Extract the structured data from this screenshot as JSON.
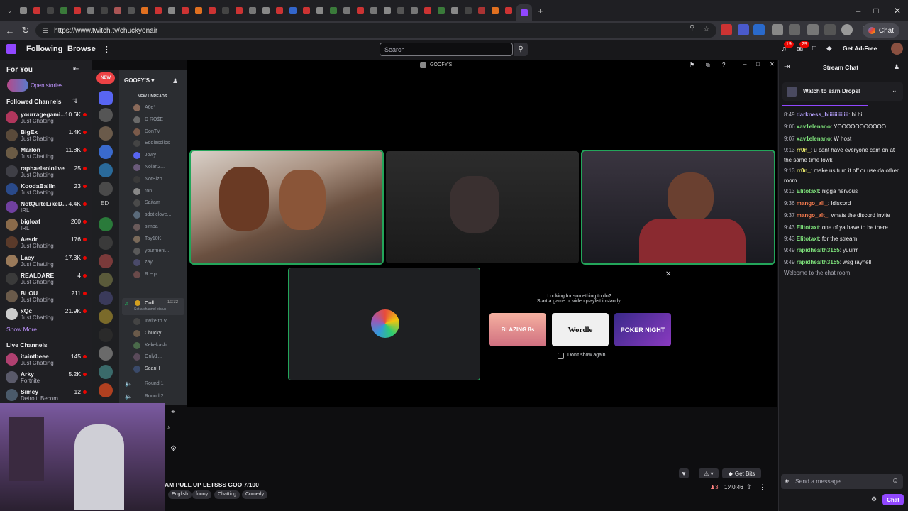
{
  "browser": {
    "url": "https://www.twitch.tv/chuckyonair",
    "chat_button": "Chat",
    "tabs_count": 44
  },
  "twitch_nav": {
    "following": "Following",
    "browse": "Browse",
    "search_placeholder": "Search",
    "notif_badge_1": "19",
    "notif_badge_2": "29",
    "get_ad_free": "Get Ad-Free"
  },
  "sidebar": {
    "for_you": "For You",
    "open_stories": "Open stories",
    "followed_header": "Followed Channels",
    "followed": [
      {
        "name": "yourragegami...",
        "category": "Just Chatting",
        "viewers": "10.6K",
        "color": "#b0365c"
      },
      {
        "name": "BigEx",
        "category": "Just Chatting",
        "viewers": "1.4K",
        "color": "#5a4a3a"
      },
      {
        "name": "Marlon",
        "category": "Just Chatting",
        "viewers": "11.8K",
        "color": "#6b5b45"
      },
      {
        "name": "raphaelsololive",
        "category": "Just Chatting",
        "viewers": "25",
        "color": "#3f3f46"
      },
      {
        "name": "KoodaBallin",
        "category": "Just Chatting",
        "viewers": "23",
        "color": "#2a4a8a"
      },
      {
        "name": "NotQuiteLikeD...",
        "category": "IRL",
        "viewers": "4.4K",
        "color": "#7040a0"
      },
      {
        "name": "bigloaf",
        "category": "IRL",
        "viewers": "260",
        "color": "#8a6a4a"
      },
      {
        "name": "Aesdr",
        "category": "Just Chatting",
        "viewers": "176",
        "color": "#5a3a2a"
      },
      {
        "name": "Lacy",
        "category": "Just Chatting",
        "viewers": "17.3K",
        "color": "#9a7a5a"
      },
      {
        "name": "REALDARE",
        "category": "Just Chatting",
        "viewers": "4",
        "color": "#3a3a3a"
      },
      {
        "name": "BLOU",
        "category": "Just Chatting",
        "viewers": "211",
        "color": "#6a5a4a"
      },
      {
        "name": "xQc",
        "category": "Just Chatting",
        "viewers": "21.9K",
        "color": "#cccccc"
      }
    ],
    "show_more": "Show More",
    "live_header": "Live Channels",
    "live": [
      {
        "name": "itaintbeee",
        "category": "Just Chatting",
        "viewers": "145",
        "color": "#b04070"
      },
      {
        "name": "Arky",
        "category": "Fortnite",
        "viewers": "5.2K",
        "color": "#5a5a6a"
      },
      {
        "name": "Simey",
        "category": "Detroit: Becom...",
        "viewers": "12",
        "color": "#4a5a6a"
      }
    ]
  },
  "discord": {
    "server_name": "GOOFY'S",
    "new_unreads": "NEW UNREADS",
    "window_title": "GOOFY'S",
    "channels": [
      "A6e*",
      "D RO$E",
      "DonTV",
      "Eddiesclips",
      "Jowy",
      "Nolan2...",
      "NotBizo",
      "ron...",
      "Saitam",
      "sdot clove...",
      "simba",
      "Tay10K",
      "yourmeni...",
      "zay",
      "R e p..."
    ],
    "voice_channel": "Coll...",
    "voice_time": "10:32",
    "voice_status": "Set a channel status",
    "voice_users": [
      "Invite to V...",
      "Chucky",
      "Kekekash...",
      "Only1...",
      "SeanH"
    ],
    "rounds": [
      "Round 1",
      "Round 2"
    ],
    "server_label_ed": "ED",
    "activity_prompt_line1": "Looking for something to do?",
    "activity_prompt_line2": "Start a game or video playlist instantly.",
    "activities": [
      "BLAZING 8s",
      "Wordle",
      "POKER NIGHT"
    ],
    "dont_show": "Don't show again"
  },
  "stream": {
    "title": "AM PULL UP LETSSS GOO 7/100",
    "tags": [
      "English",
      "funny",
      "Chatting",
      "Comedy"
    ],
    "viewers": "3",
    "uptime": "1:40:46",
    "get_bits": "Get Bits"
  },
  "chat": {
    "header": "Stream Chat",
    "drops": "Watch to earn Drops!",
    "messages": [
      {
        "time": "8:49",
        "user": "darkness_hiiiiiiiiiiiii",
        "text": "hi hi",
        "color": "#b09cf4"
      },
      {
        "time": "9:06",
        "user": "xav1elenano",
        "text": "YOOOOOOOOOOO",
        "color": "#7de07a"
      },
      {
        "time": "9:07",
        "user": "xav1elenano",
        "text": "W host",
        "color": "#7de07a"
      },
      {
        "time": "9:13",
        "user": "rr0n_",
        "text": "u cant have everyone cam on at the same time lowk",
        "color": "#e8e86a"
      },
      {
        "time": "9:13",
        "user": "rr0n_",
        "text": "make us turn it off or use da other room",
        "color": "#e8e86a"
      },
      {
        "time": "9:13",
        "user": "Elitotaxt",
        "text": "nigga nervous",
        "color": "#7de07a"
      },
      {
        "time": "9:36",
        "user": "mango_ali_",
        "text": "Idiscord",
        "color": "#ff7f50"
      },
      {
        "time": "9:37",
        "user": "mango_alt_",
        "text": "whats the discord invite",
        "color": "#ff7f50"
      },
      {
        "time": "9:43",
        "user": "Elitotaxt",
        "text": "one of ya have to be there",
        "color": "#7de07a"
      },
      {
        "time": "9:43",
        "user": "Elitotaxt",
        "text": "for the stream",
        "color": "#7de07a"
      },
      {
        "time": "9:49",
        "user": "rapidhealth3155",
        "text": "yuurrr",
        "color": "#7de07a"
      },
      {
        "time": "9:49",
        "user": "rapidhealth3155",
        "text": "wsg raynell",
        "color": "#7de07a"
      }
    ],
    "welcome": "Welcome to the chat room!",
    "send_placeholder": "Send a message",
    "chat_button": "Chat"
  },
  "colors": {
    "twitch_purple": "#9147ff",
    "discord_green": "#23a55a",
    "live_red": "#eb0400"
  }
}
